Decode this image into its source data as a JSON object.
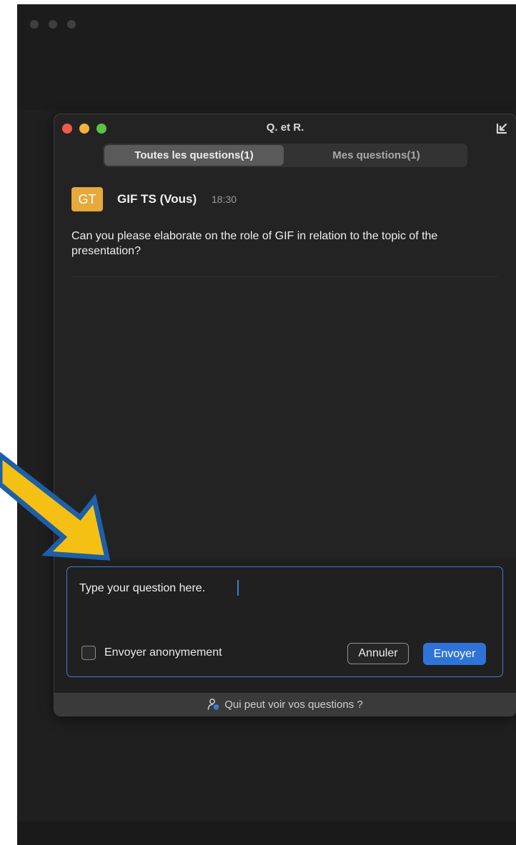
{
  "window": {
    "title": "Q. et R."
  },
  "tabs": [
    {
      "label": "Toutes les questions(1)",
      "active": true
    },
    {
      "label": "Mes questions(1)",
      "active": false
    }
  ],
  "question": {
    "avatar_initials": "GT",
    "author": "GIF TS (Vous)",
    "time": "18:30",
    "text": "Can you please elaborate on the role of GIF in relation to the topic of the presentation?"
  },
  "compose": {
    "value": "Type your question here.",
    "anonymous_label": "Envoyer anonymement",
    "anonymous_checked": false,
    "cancel_label": "Annuler",
    "send_label": "Envoyer"
  },
  "footer": {
    "link": "Qui peut voir vos questions ?"
  },
  "colors": {
    "accent": "#2f73d9",
    "avatar": "#e7a93c",
    "arrow_fill": "#f4c013",
    "arrow_outline": "#1d5fa8"
  }
}
